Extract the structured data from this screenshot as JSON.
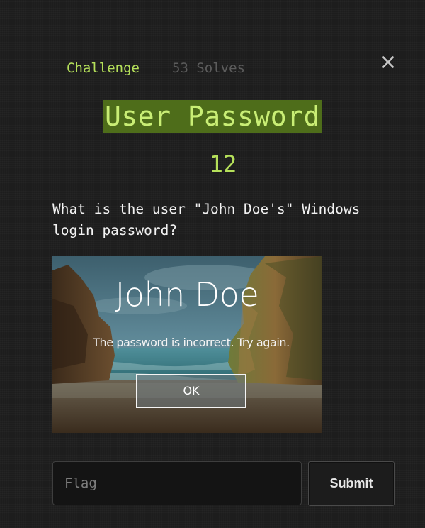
{
  "tabs": {
    "challenge": "Challenge",
    "solves": "53 Solves"
  },
  "close_symbol": "×",
  "challenge": {
    "title": "User Password",
    "points": "12",
    "question": "What is the user \"John Doe's\" Windows login password?"
  },
  "image": {
    "user_name": "John Doe",
    "message": "The password is incorrect. Try again.",
    "ok_label": "OK"
  },
  "flag": {
    "value": "",
    "placeholder": "Flag"
  },
  "submit_label": "Submit",
  "colors": {
    "accent": "#b5e05a",
    "title_bg": "#4e6d1a",
    "background": "#1d1d1d"
  }
}
